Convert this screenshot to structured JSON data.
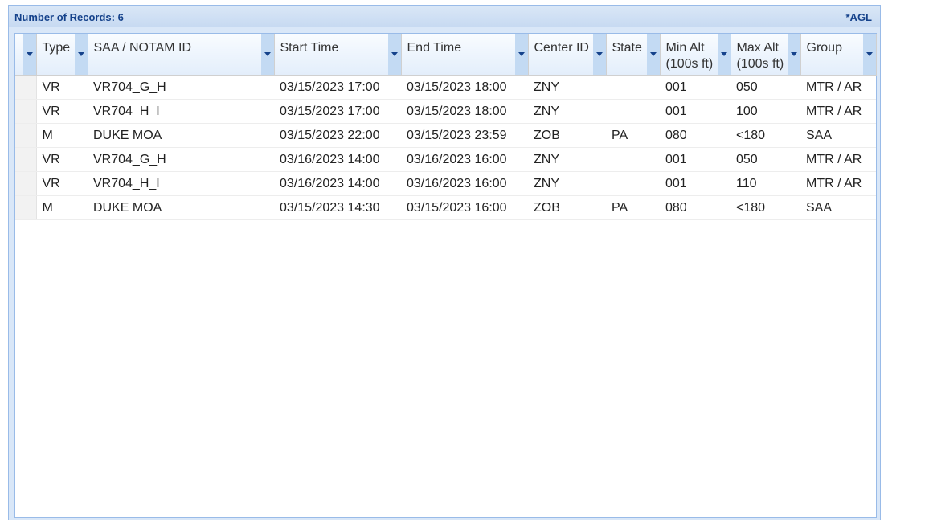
{
  "panel": {
    "title": "Number of Records: 6",
    "note": "*AGL"
  },
  "columns": [
    "Type",
    "SAA / NOTAM ID",
    "Start Time",
    "End Time",
    "Center ID",
    "State",
    "Min Alt\n(100s ft)",
    "Max Alt\n(100s ft)",
    "Group"
  ],
  "columns_lines": {
    "min_alt": [
      "Min Alt",
      "(100s ft)"
    ],
    "max_alt": [
      "Max Alt",
      "(100s ft)"
    ]
  },
  "rows": [
    [
      "VR",
      "VR704_G_H",
      "03/15/2023 17:00",
      "03/15/2023 18:00",
      "ZNY",
      "",
      "001",
      "050",
      "MTR / AR"
    ],
    [
      "VR",
      "VR704_H_I",
      "03/15/2023 17:00",
      "03/15/2023 18:00",
      "ZNY",
      "",
      "001",
      "100",
      "MTR / AR"
    ],
    [
      "M",
      "DUKE MOA",
      "03/15/2023 22:00",
      "03/15/2023 23:59",
      "ZOB",
      "PA",
      "080",
      "<180",
      "SAA"
    ],
    [
      "VR",
      "VR704_G_H",
      "03/16/2023 14:00",
      "03/16/2023 16:00",
      "ZNY",
      "",
      "001",
      "050",
      "MTR / AR"
    ],
    [
      "VR",
      "VR704_H_I",
      "03/16/2023 14:00",
      "03/16/2023 16:00",
      "ZNY",
      "",
      "001",
      "110",
      "MTR / AR"
    ],
    [
      "M",
      "DUKE MOA",
      "03/15/2023 14:30",
      "03/15/2023 16:00",
      "ZOB",
      "PA",
      "080",
      "<180",
      "SAA"
    ]
  ]
}
